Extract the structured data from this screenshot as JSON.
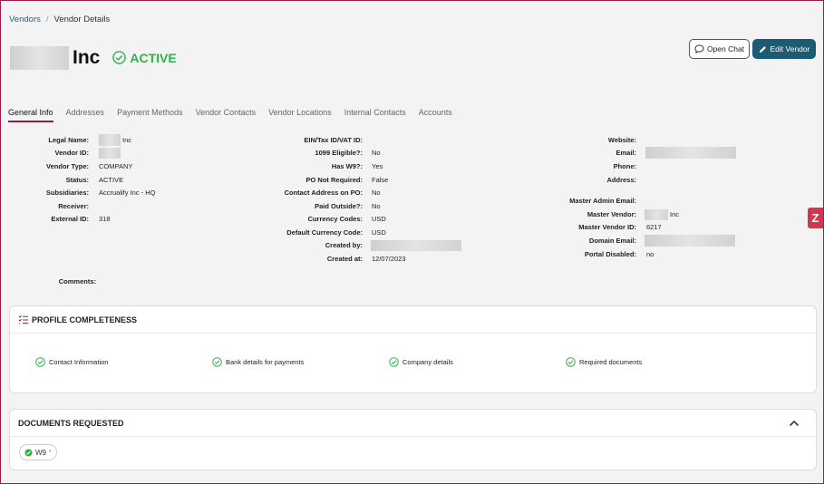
{
  "breadcrumb": {
    "root": "Vendors",
    "separator": "/",
    "current": "Vendor Details"
  },
  "vendor": {
    "title_suffix": "Inc",
    "status": "ACTIVE"
  },
  "actions": {
    "open_chat": "Open Chat",
    "edit_vendor": "Edit Vendor"
  },
  "tabs": [
    "General Info",
    "Addresses",
    "Payment Methods",
    "Vendor Contacts",
    "Vendor Locations",
    "Internal Contacts",
    "Accounts"
  ],
  "col1": [
    {
      "label": "Legal Name:",
      "value": "Inc"
    },
    {
      "label": "Vendor ID:",
      "value": ""
    },
    {
      "label": "Vendor Type:",
      "value": "COMPANY"
    },
    {
      "label": "Status:",
      "value": "ACTIVE"
    },
    {
      "label": "Subsidiaries:",
      "value": "Accrualify Inc - HQ"
    },
    {
      "label": "Receiver:",
      "value": ""
    },
    {
      "label": "External ID:",
      "value": "318"
    }
  ],
  "col2": [
    {
      "label": "EIN/Tax ID/VAT ID:",
      "value": ""
    },
    {
      "label": "1099 Eligible?:",
      "value": "No"
    },
    {
      "label": "Has W9?:",
      "value": "Yes"
    },
    {
      "label": "PO Not Required:",
      "value": "False"
    },
    {
      "label": "Contact Address on PO:",
      "value": "No"
    },
    {
      "label": "Paid Outside?:",
      "value": "No"
    },
    {
      "label": "Currency Codes:",
      "value": "USD"
    },
    {
      "label": "Default Currency Code:",
      "value": "USD"
    },
    {
      "label": "Created by:",
      "value": ""
    },
    {
      "label": "Created at:",
      "value": "12/07/2023"
    }
  ],
  "col3": [
    {
      "label": "Website:",
      "value": ""
    },
    {
      "label": "Email:",
      "value": ""
    },
    {
      "label": "Phone:",
      "value": ""
    },
    {
      "label": "Address:",
      "value": ""
    },
    {
      "label": "Master Admin Email:",
      "value": ""
    },
    {
      "label": "Master Vendor:",
      "value": "Inc"
    },
    {
      "label": "Master Vendor ID:",
      "value": "6217"
    },
    {
      "label": "Domain Email:",
      "value": ""
    },
    {
      "label": "Portal Disabled:",
      "value": "no"
    }
  ],
  "comments_label": "Comments:",
  "side_tab_glyph": "Z",
  "profile": {
    "title": "PROFILE COMPLETENESS",
    "items": [
      "Contact Information",
      "Bank details for payments",
      "Company details",
      "Required documents"
    ]
  },
  "documents": {
    "title": "DOCUMENTS REQUESTED",
    "chip": "W9",
    "chip_mark": "*"
  },
  "colors": {
    "brand": "#9b1b4b",
    "primary_button": "#1d5b73",
    "success": "#2fb24a"
  }
}
